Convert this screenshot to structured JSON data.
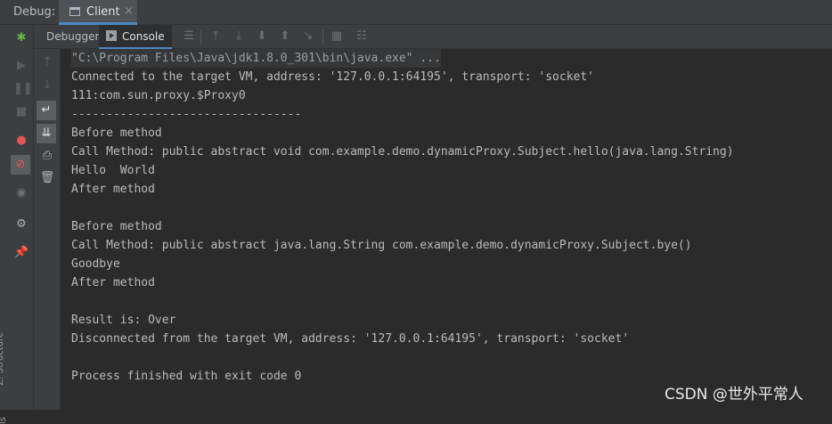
{
  "header": {
    "debug_label": "Debug:",
    "tab_label": "Client",
    "tab_close": "×"
  },
  "toolbar": {
    "debugger_label": "Debugger",
    "console_label": "Console"
  },
  "sidebar": {
    "structure_label": "Z: Structure",
    "bottom_label": "ls"
  },
  "console": {
    "lines": [
      "\"C:\\Program Files\\Java\\jdk1.8.0_301\\bin\\java.exe\" ...",
      "Connected to the target VM, address: '127.0.0.1:64195', transport: 'socket'",
      "111:com.sun.proxy.$Proxy0",
      "---------------------------------",
      "Before method",
      "Call Method: public abstract void com.example.demo.dynamicProxy.Subject.hello(java.lang.String)",
      "Hello  World",
      "After method",
      "",
      "Before method",
      "Call Method: public abstract java.lang.String com.example.demo.dynamicProxy.Subject.bye()",
      "Goodbye",
      "After method",
      "",
      "Result is: Over",
      "Disconnected from the target VM, address: '127.0.0.1:64195', transport: 'socket'",
      "",
      "Process finished with exit code 0"
    ]
  },
  "watermark": "CSDN @世外平常人",
  "colors": {
    "background": "#2b2b2b",
    "panel": "#3c3f41",
    "accent": "#4a88c7",
    "text": "#bbbbbb"
  }
}
